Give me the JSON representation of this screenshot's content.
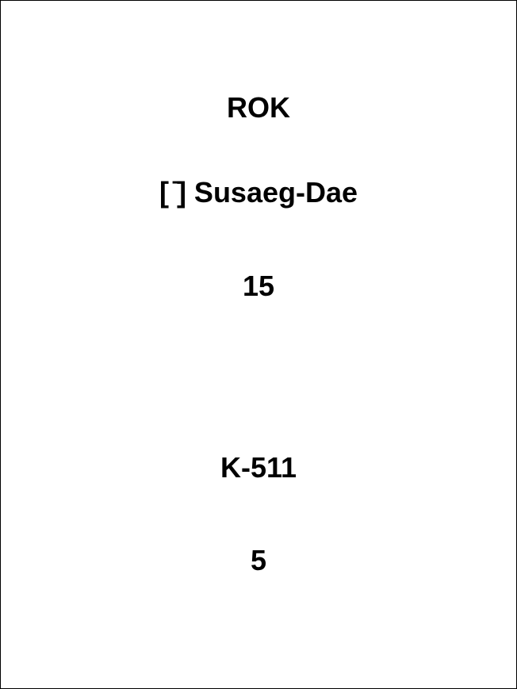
{
  "card": {
    "lines": [
      "ROK",
      "[ ̄] Susaeg-Dae",
      "15",
      "K-511",
      "5"
    ]
  }
}
